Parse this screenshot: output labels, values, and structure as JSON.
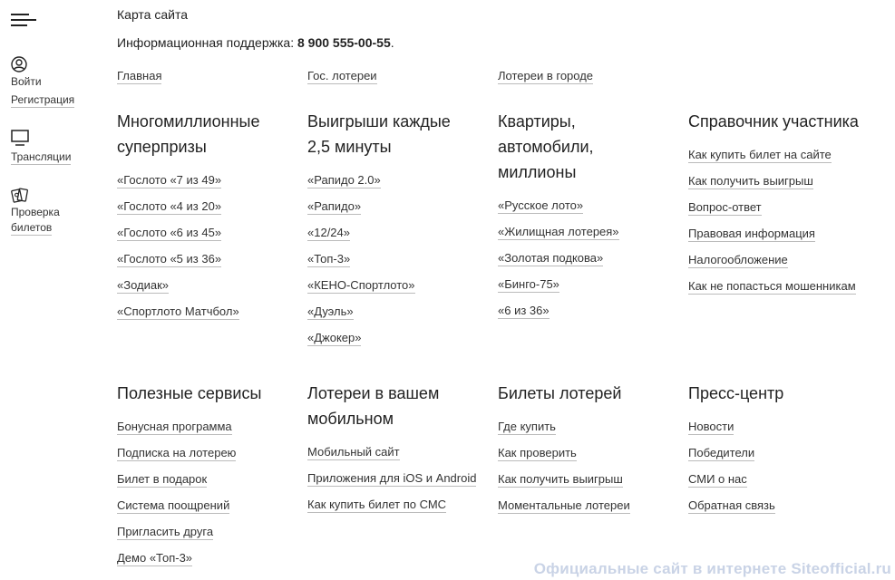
{
  "sidebar": {
    "login": "Войти",
    "register": "Регистрация",
    "broadcasts": "Трансляции",
    "check_line1": "Проверка",
    "check_line2": "билетов"
  },
  "header": {
    "title": "Карта сайта",
    "support_label": "Информационная поддержка: ",
    "support_phone": "8 900 555-00-55",
    "support_suffix": "."
  },
  "toplinks": [
    "Главная",
    "Гос. лотереи",
    "Лотереи в городе"
  ],
  "sections": [
    {
      "title_lines": [
        "Многомиллионные",
        "суперпризы"
      ],
      "links": [
        "«Гослото «7 из 49»",
        "«Гослото «4 из 20»",
        "«Гослото «6 из 45»",
        "«Гослото «5 из 36»",
        "«Зодиак»",
        "«Спортлото Матчбол»"
      ]
    },
    {
      "title_lines": [
        "Выигрыши каждые",
        "2,5 минуты"
      ],
      "links": [
        "«Рапидо 2.0»",
        "«Рапидо»",
        "«12/24»",
        "«Топ-3»",
        "«КЕНО-Спортлото»",
        "«Дуэль»",
        "«Джокер»"
      ]
    },
    {
      "title_lines": [
        "Квартиры,",
        "автомобили,",
        "миллионы"
      ],
      "links": [
        "«Русское лото»",
        "«Жилищная лотерея»",
        "«Золотая подкова»",
        "«Бинго-75»",
        "«6 из 36»"
      ]
    },
    {
      "title_lines": [
        "Справочник участника"
      ],
      "links": [
        "Как купить билет на сайте",
        "Как получить выигрыш",
        "Вопрос-ответ",
        "Правовая информация",
        "Налогообложение",
        "Как не попасться мошенникам"
      ]
    },
    {
      "title_lines": [
        "Полезные сервисы"
      ],
      "links": [
        "Бонусная программа",
        "Подписка на лотерею",
        "Билет в подарок",
        "Система поощрений",
        "Пригласить друга",
        "Демо «Топ-3»"
      ]
    },
    {
      "title_lines": [
        "Лотереи в вашем",
        "мобильном"
      ],
      "links": [
        "Мобильный сайт",
        "Приложения для iOS и Android",
        "Как купить билет по СМС"
      ]
    },
    {
      "title_lines": [
        "Билеты лотерей"
      ],
      "links": [
        "Где купить",
        "Как проверить",
        "Как получить выигрыш",
        "Моментальные лотереи"
      ]
    },
    {
      "title_lines": [
        "Пресс-центр"
      ],
      "links": [
        "Новости",
        "Победители",
        "СМИ о нас",
        "Обратная связь"
      ]
    }
  ],
  "watermark": "Официальные сайт в интернете Siteofficial.ru",
  "icons": [
    "menu-icon",
    "user-icon",
    "tv-icon",
    "tickets-icon"
  ]
}
